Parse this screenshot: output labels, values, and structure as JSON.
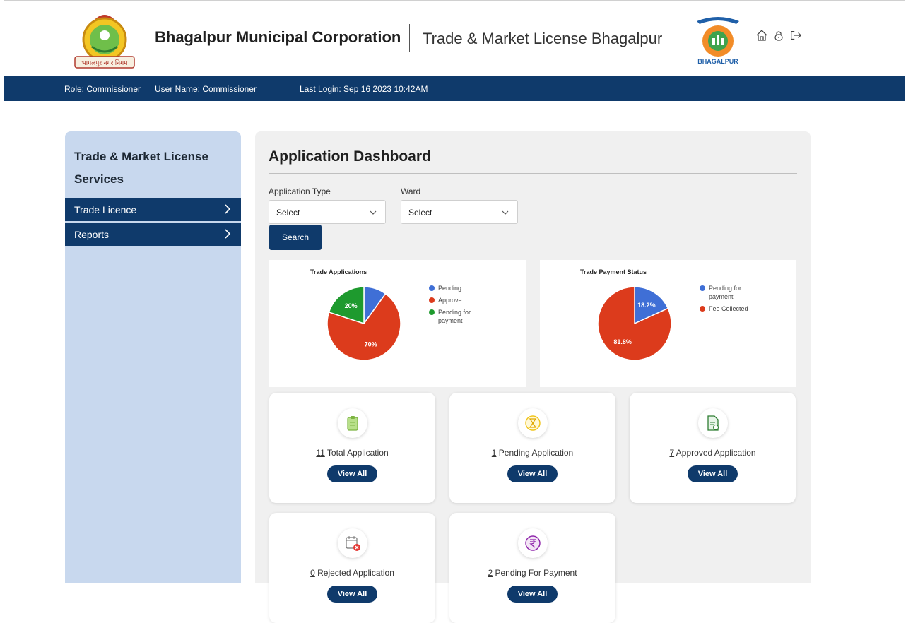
{
  "header": {
    "org_name": "Bhagalpur Municipal Corporation",
    "app_name": "Trade & Market License Bhagalpur",
    "left_logo_text": "भागलपुर नगर निगम",
    "right_logo_text": "BHAGALPUR",
    "icons": [
      "home-icon",
      "lock-icon",
      "logout-icon"
    ]
  },
  "infobar": {
    "role": "Role: Commissioner",
    "user": "User Name: Commissioner",
    "last_login": "Last Login: Sep 16 2023 10:42AM"
  },
  "sidebar": {
    "title": "Trade & Market License Services",
    "items": [
      {
        "label": "Trade Licence"
      },
      {
        "label": "Reports"
      }
    ]
  },
  "main": {
    "title": "Application Dashboard",
    "filters": {
      "application_type_label": "Application Type",
      "application_type_value": "Select",
      "ward_label": "Ward",
      "ward_value": "Select",
      "search_label": "Search"
    }
  },
  "chart_data": [
    {
      "type": "pie",
      "title": "Trade Applications",
      "categories": [
        "Pending",
        "Approve",
        "Pending for payment"
      ],
      "values": [
        10,
        70,
        20
      ],
      "labels_shown": [
        "",
        "70%",
        "20%"
      ],
      "colors": [
        "#3f6fd6",
        "#dc3b1c",
        "#1e9a2e"
      ],
      "legend": "right"
    },
    {
      "type": "pie",
      "title": "Trade Payment Status",
      "categories": [
        "Pending for payment",
        "Fee Collected"
      ],
      "values": [
        18.2,
        81.8
      ],
      "labels_shown": [
        "18.2%",
        "81.8%"
      ],
      "colors": [
        "#3f6fd6",
        "#dc3b1c"
      ],
      "legend": "right"
    }
  ],
  "stats": [
    {
      "count": "11",
      "label": " Total Application",
      "button": "View All",
      "icon": "clipboard-icon"
    },
    {
      "count": "1",
      "label": " Pending Application",
      "button": "View All",
      "icon": "hourglass-icon"
    },
    {
      "count": "7",
      "label": " Approved Application",
      "button": "View All",
      "icon": "approved-document-icon"
    },
    {
      "count": "0",
      "label": " Rejected Application",
      "button": "View All",
      "icon": "rejected-calendar-icon"
    },
    {
      "count": "2",
      "label": " Pending For Payment",
      "button": "View All",
      "icon": "rupee-icon"
    }
  ],
  "colors": {
    "navy": "#0f3a6b",
    "sidebar_bg": "#c8d8ee",
    "panel_bg": "#f0f0f0"
  }
}
